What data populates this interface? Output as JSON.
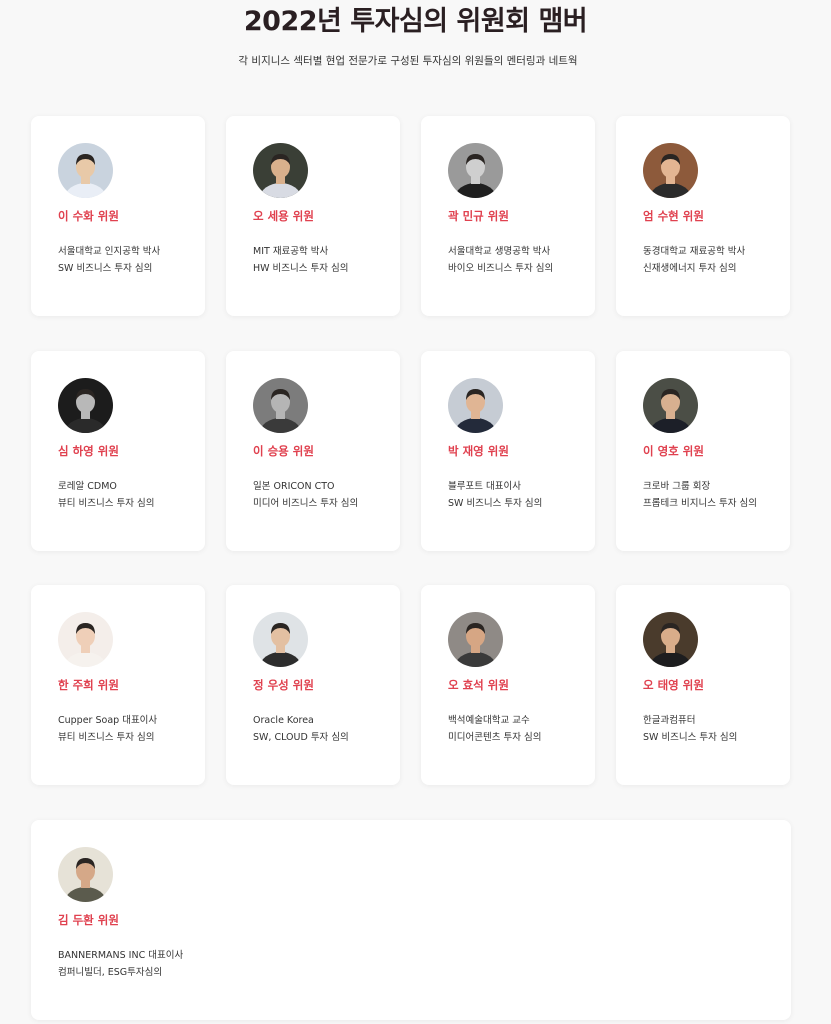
{
  "header": {
    "title": "2022년 투자심의 위원회 맴버",
    "subtitle": "각 비지니스 섹터별 현업 전문가로 구성된 투자심의 위원들의 멘터링과 네트웍"
  },
  "members": [
    {
      "name": "이 수화 위원",
      "line1": "서울대학교 인지공학 박사",
      "line2": "SW 비즈니스 투자 심의",
      "avatar_bg": "#c9d3de",
      "avatar_tone": "#e8c9a8",
      "avatar_cloth": "#e9eef6"
    },
    {
      "name": "오 세용 위원",
      "line1": "MIT 재료공학 박사",
      "line2": "HW 비즈니스 투자 심의",
      "avatar_bg": "#3a3f36",
      "avatar_tone": "#d9b08c",
      "avatar_cloth": "#d8dbe3"
    },
    {
      "name": "곽 민규 위원",
      "line1": "서울대학교 생명공학 박사",
      "line2": "바이오 비즈니스 투자 심의",
      "avatar_bg": "#9a9a9a",
      "avatar_tone": "#cfcfcf",
      "avatar_cloth": "#1f1f1f"
    },
    {
      "name": "엄 수현 위원",
      "line1": "동경대학교 재료공학 박사",
      "line2": "신재생에너지 투자 심의",
      "avatar_bg": "#8d5a3b",
      "avatar_tone": "#e3b592",
      "avatar_cloth": "#2b2b2b"
    },
    {
      "name": "심 하영 위원",
      "line1": "로레알 CDMO",
      "line2": "뷰티 비즈니스 투자 심의",
      "avatar_bg": "#1c1c1c",
      "avatar_tone": "#b8b8b8",
      "avatar_cloth": "#2a2a2a"
    },
    {
      "name": "이 승용 위원",
      "line1": "일본 ORICON CTO",
      "line2": "미디어 비즈니스 투자 심의",
      "avatar_bg": "#7c7c7c",
      "avatar_tone": "#b5b5b5",
      "avatar_cloth": "#3a3a3a"
    },
    {
      "name": "박 재영 위원",
      "line1": "블루포트 대표이사",
      "line2": "SW 비즈니스 투자 심의",
      "avatar_bg": "#c6ccd4",
      "avatar_tone": "#e0b594",
      "avatar_cloth": "#232a3a"
    },
    {
      "name": "이 영호 위원",
      "line1": "크로바 그룹 회장",
      "line2": "프롭테크 비지니스 투자 심의",
      "avatar_bg": "#4b4e46",
      "avatar_tone": "#d8b090",
      "avatar_cloth": "#1c1f28"
    },
    {
      "name": "한 주희 위원",
      "line1": "Cupper Soap 대표이사",
      "line2": "뷰티 비즈니스 투자 심의",
      "avatar_bg": "#f4eeea",
      "avatar_tone": "#efcfb8",
      "avatar_cloth": "#f6f2ee"
    },
    {
      "name": "정 우성 위원",
      "line1": "Oracle Korea",
      "line2": "SW, CLOUD 투자 심의",
      "avatar_bg": "#dfe3e6",
      "avatar_tone": "#e3c0a2",
      "avatar_cloth": "#2d2d2d"
    },
    {
      "name": "오 효석 위원",
      "line1": "백석예술대학교 교수",
      "line2": "미디어콘텐츠 투자 심의",
      "avatar_bg": "#8f8a86",
      "avatar_tone": "#d6a684",
      "avatar_cloth": "#3a3a3a"
    },
    {
      "name": "오 태영 위원",
      "line1": "한글과컴퓨터",
      "line2": "SW 비즈니스 투자 심의",
      "avatar_bg": "#4a3b2c",
      "avatar_tone": "#d9ad8a",
      "avatar_cloth": "#1d1d1f"
    },
    {
      "name": "김 두환 위원",
      "line1": "BANNERMANS INC 대표이사",
      "line2": "컴퍼니빌더, ESG투자심의",
      "avatar_bg": "#e6e2d7",
      "avatar_tone": "#d5a888",
      "avatar_cloth": "#5b5b4d"
    }
  ]
}
